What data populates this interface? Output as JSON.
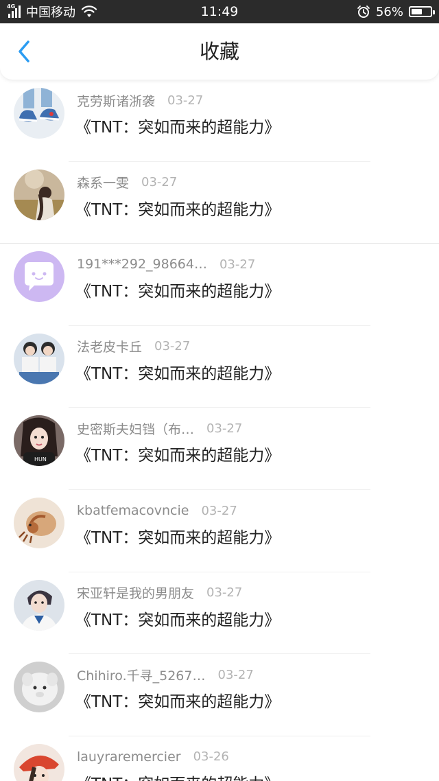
{
  "status_bar": {
    "network_type": "4G",
    "carrier": "中国移动",
    "time": "11:49",
    "battery_percent": "56%",
    "battery_level": 0.56,
    "icons": [
      "signal-icon",
      "wifi-icon",
      "alarm-icon",
      "battery-icon"
    ]
  },
  "header": {
    "title": "收藏",
    "back_icon": "chevron-left-icon",
    "accent_color": "#2b9cf2"
  },
  "items": [
    {
      "username": "克劳斯诸浙袭",
      "date": "03-27",
      "title": "《TNT：突如而来的超能力》",
      "avatar": "avatar-sneakers"
    },
    {
      "username": "森系一雯",
      "date": "03-27",
      "title": "《TNT：突如而来的超能力》",
      "avatar": "avatar-girl-field"
    },
    {
      "username": "191***292_98664…",
      "date": "03-27",
      "title": "《TNT：突如而来的超能力》",
      "avatar": "avatar-default-chat"
    },
    {
      "username": "法老皮卡丘",
      "date": "03-27",
      "title": "《TNT：突如而来的超能力》",
      "avatar": "avatar-two-boys"
    },
    {
      "username": "史密斯夫妇铛（布…",
      "date": "03-27",
      "title": "《TNT：突如而来的超能力》",
      "avatar": "avatar-girl-selfie"
    },
    {
      "username": "kbatfemacovncie",
      "date": "03-27",
      "title": "《TNT：突如而来的超能力》",
      "avatar": "avatar-hermit-crab"
    },
    {
      "username": "宋亚轩是我的男朋友",
      "date": "03-27",
      "title": "《TNT：突如而来的超能力》",
      "avatar": "avatar-boy-uniform"
    },
    {
      "username": "Chihiro.千寻_5267…",
      "date": "03-27",
      "title": "《TNT：突如而来的超能力》",
      "avatar": "avatar-plush"
    },
    {
      "username": "lauyraremercier",
      "date": "03-26",
      "title": "《TNT：突如而来的超能力》",
      "avatar": "avatar-girl-hat"
    }
  ]
}
